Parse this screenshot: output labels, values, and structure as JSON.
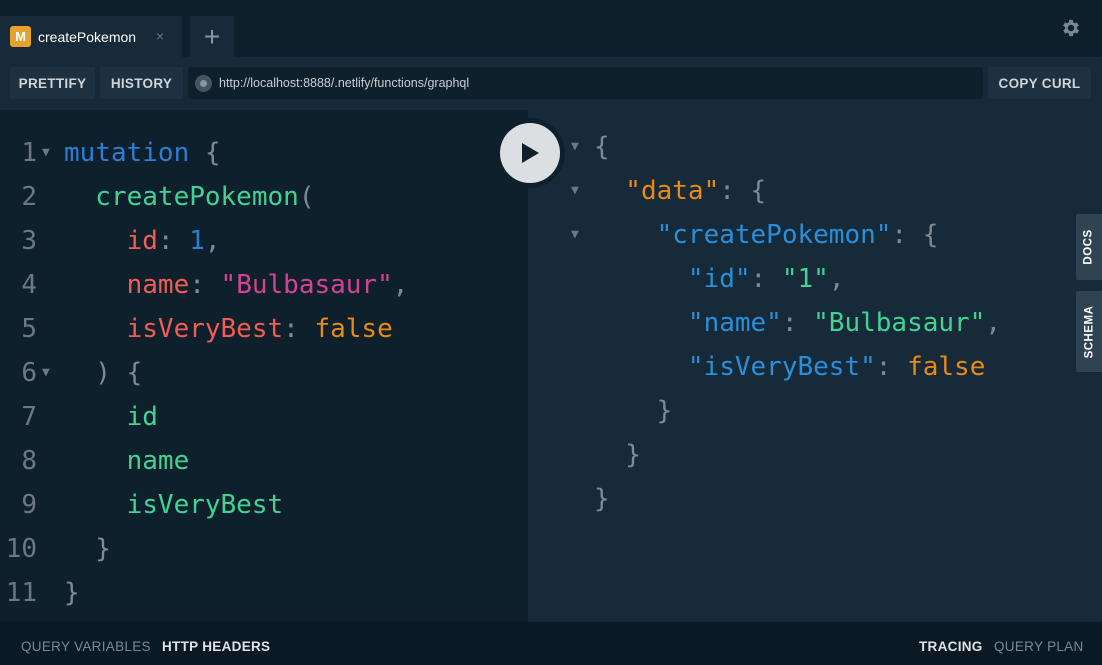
{
  "tabs": [
    {
      "badge": "M",
      "title": "createPokemon",
      "close": "×"
    }
  ],
  "tab_add": "+",
  "icons": {
    "settings": "gear-icon",
    "run": "play-icon",
    "url_status": "status-dot-icon",
    "fold": "triangle-down-icon"
  },
  "toolbar": {
    "prettify": "PRETTIFY",
    "history": "HISTORY",
    "url": "http://localhost:8888/.netlify/functions/graphql",
    "copy_curl": "COPY CURL"
  },
  "query_lines": [
    {
      "n": "1",
      "fold": true,
      "tokens": [
        {
          "t": "mutation",
          "c": "kw"
        },
        {
          "t": " {",
          "c": "punc"
        }
      ]
    },
    {
      "n": "2",
      "fold": false,
      "tokens": [
        {
          "t": "  createPokemon",
          "c": "fn"
        },
        {
          "t": "(",
          "c": "punc"
        }
      ]
    },
    {
      "n": "3",
      "fold": false,
      "tokens": [
        {
          "t": "    id",
          "c": "arg"
        },
        {
          "t": ": ",
          "c": "punc"
        },
        {
          "t": "1",
          "c": "num"
        },
        {
          "t": ",",
          "c": "punc"
        }
      ]
    },
    {
      "n": "4",
      "fold": false,
      "tokens": [
        {
          "t": "    name",
          "c": "arg"
        },
        {
          "t": ": ",
          "c": "punc"
        },
        {
          "t": "\"Bulbasaur\"",
          "c": "str"
        },
        {
          "t": ",",
          "c": "punc"
        }
      ]
    },
    {
      "n": "5",
      "fold": false,
      "tokens": [
        {
          "t": "    isVeryBest",
          "c": "arg"
        },
        {
          "t": ": ",
          "c": "punc"
        },
        {
          "t": "false",
          "c": "bool"
        }
      ]
    },
    {
      "n": "6",
      "fold": true,
      "tokens": [
        {
          "t": "  ) {",
          "c": "punc"
        }
      ]
    },
    {
      "n": "7",
      "fold": false,
      "tokens": [
        {
          "t": "    id",
          "c": "fld"
        }
      ]
    },
    {
      "n": "8",
      "fold": false,
      "tokens": [
        {
          "t": "    name",
          "c": "fld"
        }
      ]
    },
    {
      "n": "9",
      "fold": false,
      "tokens": [
        {
          "t": "    isVeryBest",
          "c": "fld"
        }
      ]
    },
    {
      "n": "10",
      "fold": false,
      "tokens": [
        {
          "t": "  }",
          "c": "punc"
        }
      ]
    },
    {
      "n": "11",
      "fold": false,
      "tokens": [
        {
          "t": "}",
          "c": "punc"
        }
      ]
    }
  ],
  "result_lines": [
    {
      "fold": true,
      "tokens": [
        {
          "t": "{",
          "c": "punc"
        }
      ]
    },
    {
      "fold": true,
      "tokens": [
        {
          "t": "  \"data\"",
          "c": "rkey0"
        },
        {
          "t": ": {",
          "c": "punc"
        }
      ]
    },
    {
      "fold": true,
      "tokens": [
        {
          "t": "    \"createPokemon\"",
          "c": "key"
        },
        {
          "t": ": {",
          "c": "punc"
        }
      ]
    },
    {
      "fold": false,
      "tokens": [
        {
          "t": "      \"id\"",
          "c": "key"
        },
        {
          "t": ": ",
          "c": "punc"
        },
        {
          "t": "\"1\"",
          "c": "rstr"
        },
        {
          "t": ",",
          "c": "punc"
        }
      ]
    },
    {
      "fold": false,
      "tokens": [
        {
          "t": "      \"name\"",
          "c": "key"
        },
        {
          "t": ": ",
          "c": "punc"
        },
        {
          "t": "\"Bulbasaur\"",
          "c": "rstr"
        },
        {
          "t": ",",
          "c": "punc"
        }
      ]
    },
    {
      "fold": false,
      "tokens": [
        {
          "t": "      \"isVeryBest\"",
          "c": "key"
        },
        {
          "t": ": ",
          "c": "punc"
        },
        {
          "t": "false",
          "c": "bool"
        }
      ]
    },
    {
      "fold": false,
      "tokens": [
        {
          "t": "    }",
          "c": "punc"
        }
      ]
    },
    {
      "fold": false,
      "tokens": [
        {
          "t": "  }",
          "c": "punc"
        }
      ]
    },
    {
      "fold": false,
      "tokens": [
        {
          "t": "}",
          "c": "punc"
        }
      ]
    }
  ],
  "side_tabs": {
    "docs": "DOCS",
    "schema": "SCHEMA"
  },
  "bottom": {
    "query_variables": "QUERY VARIABLES",
    "http_headers": "HTTP HEADERS",
    "tracing": "TRACING",
    "query_plan": "QUERY PLAN"
  },
  "colors": {
    "background": "#0f202d",
    "panel": "#172a3a",
    "badge": "#e7a12d",
    "keyword": "#2a7ed3",
    "field": "#42d392",
    "argument": "#f25c54",
    "string": "#d64292",
    "boolean": "#e98a15"
  }
}
